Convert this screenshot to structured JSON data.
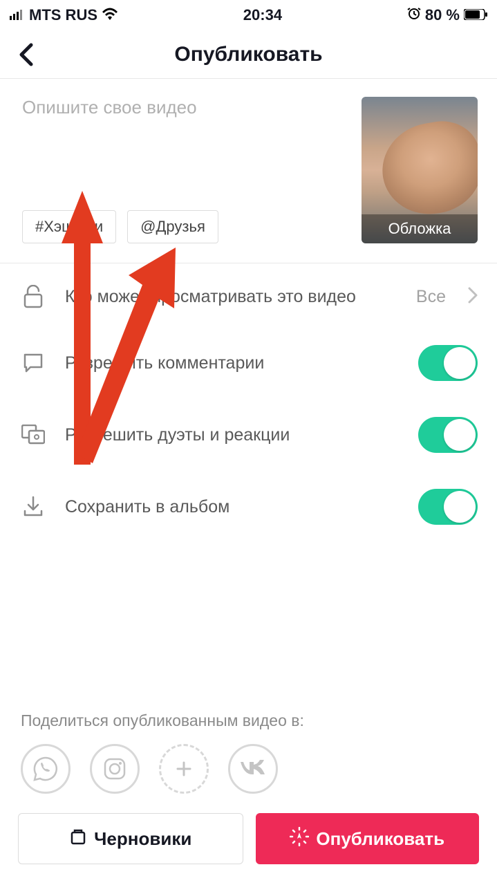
{
  "status": {
    "carrier": "MTS RUS",
    "time": "20:34",
    "battery": "80 %"
  },
  "nav": {
    "title": "Опубликовать"
  },
  "caption": {
    "placeholder": "Опишите свое видео",
    "chip_hashtag": "#Хэштеги",
    "chip_friends": "@Друзья",
    "cover_label": "Обложка"
  },
  "settings": {
    "privacy": {
      "label": "Кто может просматривать это видео",
      "value": "Все"
    },
    "comments": {
      "label": "Разрешить комментарии",
      "on": true
    },
    "duets": {
      "label": "Разрешить дуэты и реакции",
      "on": true
    },
    "save": {
      "label": "Сохранить в альбом",
      "on": true
    }
  },
  "share": {
    "label": "Поделиться опубликованным видео в:",
    "items": [
      "whatsapp",
      "instagram",
      "add-story",
      "vk"
    ]
  },
  "buttons": {
    "drafts": "Черновики",
    "publish": "Опубликовать"
  },
  "colors": {
    "primary": "#ee2a57",
    "toggle_on": "#1fcc9a",
    "annotation": "#e23b20"
  }
}
